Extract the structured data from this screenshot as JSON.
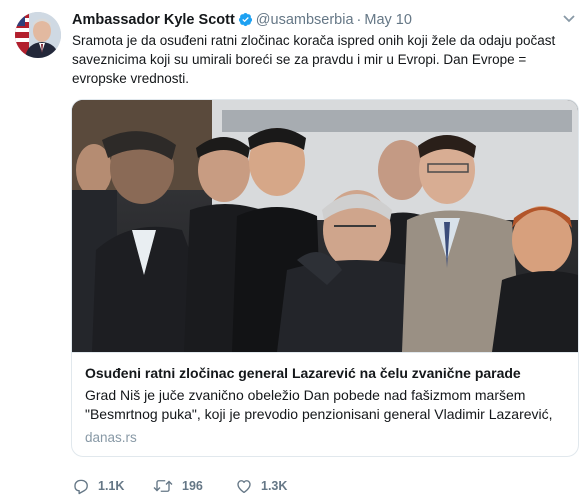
{
  "tweet": {
    "display_name": "Ambassador Kyle Scott",
    "handle": "@usambserbia",
    "separator": "·",
    "date": "May 10",
    "text": "Sramota je da osuđeni ratni zločinac korača ispred onih koji žele da odaju počast saveznicima koji su umirali boreći se za pravdu i mir u Evropi. Dan Evrope = evropske vrednosti."
  },
  "card": {
    "title": "Osuđeni ratni zločinac general Lazarević na čelu zvanične parade",
    "description": "Grad Niš je juče zvanično obeležio Dan pobede nad fašizmom maršem \"Besmrtnog puka\", koji je prevodio penzionisani general Vladimir Lazarević,",
    "domain": "danas.rs"
  },
  "actions": {
    "reply_count": "1.1K",
    "retweet_count": "196",
    "like_count": "1.3K"
  },
  "icons": [
    "verified-icon",
    "caret-down-icon",
    "reply-icon",
    "retweet-icon",
    "like-icon"
  ],
  "colors": {
    "verified": "#1da1f2",
    "muted": "#657786",
    "border": "#e1e8ed"
  }
}
